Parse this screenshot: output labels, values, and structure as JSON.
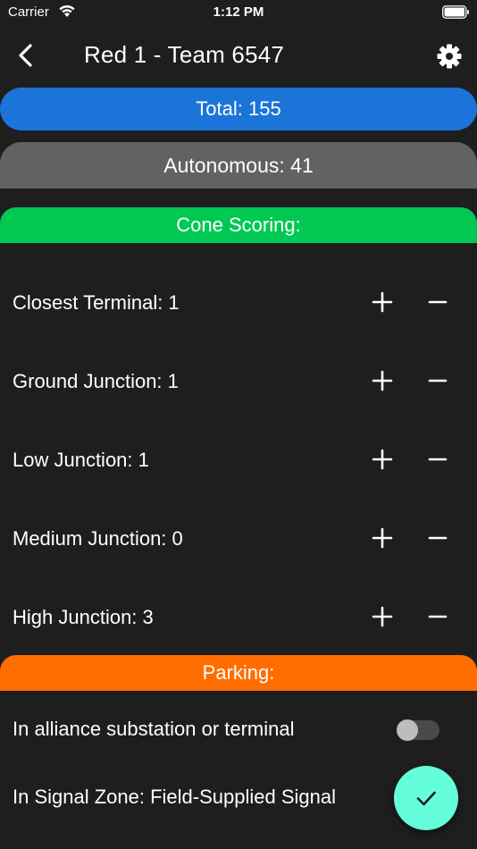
{
  "status_bar": {
    "carrier": "Carrier",
    "time": "1:12 PM"
  },
  "nav": {
    "title": "Red 1 - Team 6547",
    "back_icon": "chevron-left-icon",
    "settings_icon": "gear-icon"
  },
  "summary": {
    "total_label": "Total: 155",
    "autonomous_label": "Autonomous: 41"
  },
  "cone_scoring": {
    "header": "Cone Scoring:",
    "items": [
      {
        "label": "Closest Terminal: 1"
      },
      {
        "label": "Ground Junction: 1"
      },
      {
        "label": "Low Junction: 1"
      },
      {
        "label": "Medium Junction: 0"
      },
      {
        "label": "High Junction: 3"
      }
    ]
  },
  "parking": {
    "header": "Parking:",
    "items": [
      {
        "label": "In alliance substation or terminal",
        "toggle_on": false
      },
      {
        "label": "In Signal Zone: Field-Supplied Signal"
      }
    ]
  },
  "colors": {
    "background": "#1e1e1e",
    "total": "#1b74d8",
    "autonomous": "#626262",
    "cone_header": "#00c853",
    "parking_header": "#ff6d00",
    "fab": "#64ffda"
  },
  "fab": {
    "icon": "check-icon"
  }
}
